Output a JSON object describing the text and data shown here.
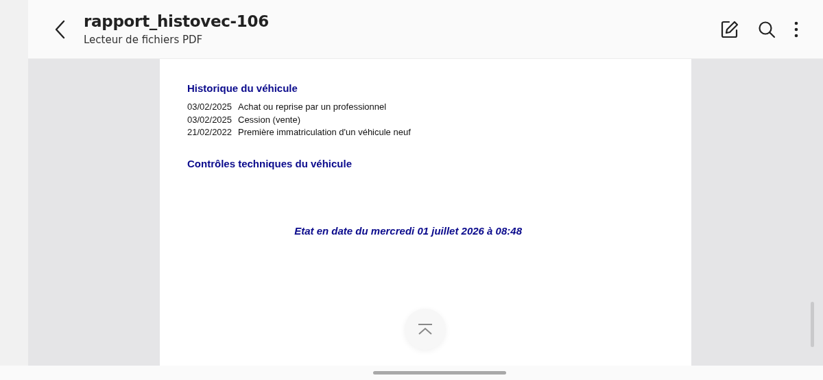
{
  "header": {
    "title": "rapport_histovec-106",
    "subtitle": "Lecteur de fichiers PDF"
  },
  "document": {
    "sections": [
      {
        "heading": "Historique du véhicule",
        "entries": [
          {
            "date": "03/02/2025",
            "event": "Achat ou reprise par un professionnel"
          },
          {
            "date": "03/02/2025",
            "event": "Cession (vente)"
          },
          {
            "date": "21/02/2022",
            "event": "Première immatriculation d'un véhicule neuf"
          }
        ]
      },
      {
        "heading": "Contrôles techniques du véhicule"
      }
    ],
    "footer": "Etat en date du mercredi 01 juillet 2026 à 08:48"
  }
}
